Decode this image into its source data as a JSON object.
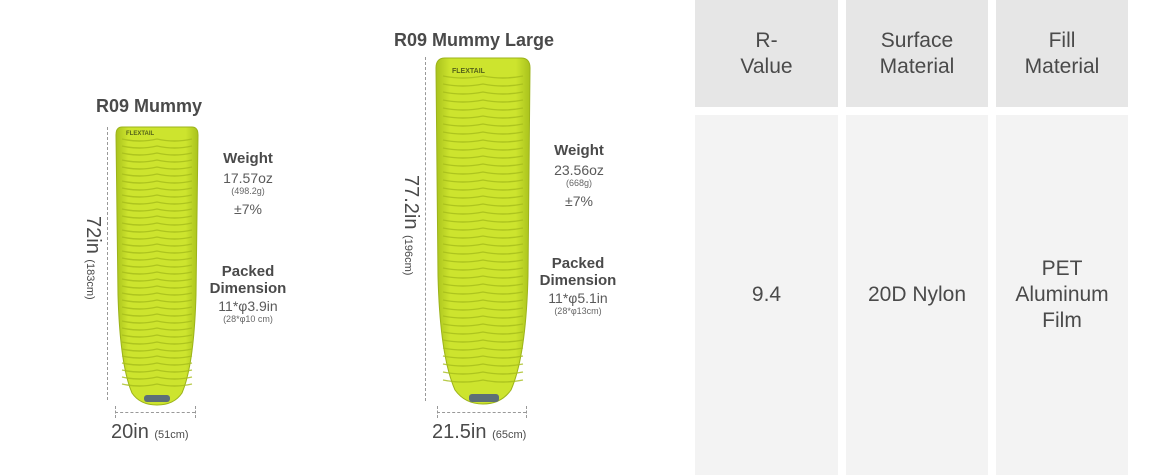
{
  "products": [
    {
      "name": "R09 Mummy",
      "weight_label": "Weight",
      "weight_oz": "17.57oz",
      "weight_g": "(498.2g)",
      "weight_tol": "±7%",
      "packed_label_1": "Packed",
      "packed_label_2": "Dimension",
      "packed_in": "11*φ3.9in",
      "packed_cm": "(28*φ10 cm)",
      "length_in": "72in",
      "length_cm": "(183cm)",
      "width_in": "20in",
      "width_cm": "(51cm)",
      "logo_text": "FLEXTAIL"
    },
    {
      "name": "R09 Mummy Large",
      "weight_label": "Weight",
      "weight_oz": "23.56oz",
      "weight_g": "(668g)",
      "weight_tol": "±7%",
      "packed_label_1": "Packed",
      "packed_label_2": "Dimension",
      "packed_in": "11*φ5.1in",
      "packed_cm": "(28*φ13cm)",
      "length_in": "77.2in",
      "length_cm": "(196cm)",
      "width_in": "21.5in",
      "width_cm": "(65cm)",
      "logo_text": "FLEXTAIL"
    }
  ],
  "table": {
    "headers": [
      {
        "line1": "R-",
        "line2": "Value"
      },
      {
        "line1": "Surface",
        "line2": "Material"
      },
      {
        "line1": "Fill",
        "line2": "Material"
      }
    ],
    "values": [
      {
        "line1": "9.4",
        "line2": "",
        "line3": ""
      },
      {
        "line1": "20D Nylon",
        "line2": "",
        "line3": ""
      },
      {
        "line1": "PET",
        "line2": "Aluminum",
        "line3": "Film"
      }
    ]
  },
  "colors": {
    "mat_green": "#c9e02a",
    "mat_shadow": "#9fb51c",
    "table_header_bg": "#e6e6e6",
    "table_body_bg": "#f3f3f3"
  }
}
